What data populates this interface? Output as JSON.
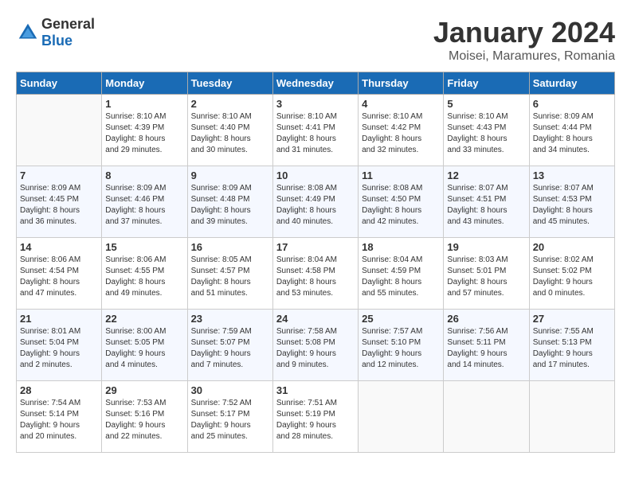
{
  "logo": {
    "general": "General",
    "blue": "Blue"
  },
  "header": {
    "month": "January 2024",
    "location": "Moisei, Maramures, Romania"
  },
  "weekdays": [
    "Sunday",
    "Monday",
    "Tuesday",
    "Wednesday",
    "Thursday",
    "Friday",
    "Saturday"
  ],
  "weeks": [
    [
      {
        "day": "",
        "info": ""
      },
      {
        "day": "1",
        "info": "Sunrise: 8:10 AM\nSunset: 4:39 PM\nDaylight: 8 hours\nand 29 minutes."
      },
      {
        "day": "2",
        "info": "Sunrise: 8:10 AM\nSunset: 4:40 PM\nDaylight: 8 hours\nand 30 minutes."
      },
      {
        "day": "3",
        "info": "Sunrise: 8:10 AM\nSunset: 4:41 PM\nDaylight: 8 hours\nand 31 minutes."
      },
      {
        "day": "4",
        "info": "Sunrise: 8:10 AM\nSunset: 4:42 PM\nDaylight: 8 hours\nand 32 minutes."
      },
      {
        "day": "5",
        "info": "Sunrise: 8:10 AM\nSunset: 4:43 PM\nDaylight: 8 hours\nand 33 minutes."
      },
      {
        "day": "6",
        "info": "Sunrise: 8:09 AM\nSunset: 4:44 PM\nDaylight: 8 hours\nand 34 minutes."
      }
    ],
    [
      {
        "day": "7",
        "info": "Sunrise: 8:09 AM\nSunset: 4:45 PM\nDaylight: 8 hours\nand 36 minutes."
      },
      {
        "day": "8",
        "info": "Sunrise: 8:09 AM\nSunset: 4:46 PM\nDaylight: 8 hours\nand 37 minutes."
      },
      {
        "day": "9",
        "info": "Sunrise: 8:09 AM\nSunset: 4:48 PM\nDaylight: 8 hours\nand 39 minutes."
      },
      {
        "day": "10",
        "info": "Sunrise: 8:08 AM\nSunset: 4:49 PM\nDaylight: 8 hours\nand 40 minutes."
      },
      {
        "day": "11",
        "info": "Sunrise: 8:08 AM\nSunset: 4:50 PM\nDaylight: 8 hours\nand 42 minutes."
      },
      {
        "day": "12",
        "info": "Sunrise: 8:07 AM\nSunset: 4:51 PM\nDaylight: 8 hours\nand 43 minutes."
      },
      {
        "day": "13",
        "info": "Sunrise: 8:07 AM\nSunset: 4:53 PM\nDaylight: 8 hours\nand 45 minutes."
      }
    ],
    [
      {
        "day": "14",
        "info": "Sunrise: 8:06 AM\nSunset: 4:54 PM\nDaylight: 8 hours\nand 47 minutes."
      },
      {
        "day": "15",
        "info": "Sunrise: 8:06 AM\nSunset: 4:55 PM\nDaylight: 8 hours\nand 49 minutes."
      },
      {
        "day": "16",
        "info": "Sunrise: 8:05 AM\nSunset: 4:57 PM\nDaylight: 8 hours\nand 51 minutes."
      },
      {
        "day": "17",
        "info": "Sunrise: 8:04 AM\nSunset: 4:58 PM\nDaylight: 8 hours\nand 53 minutes."
      },
      {
        "day": "18",
        "info": "Sunrise: 8:04 AM\nSunset: 4:59 PM\nDaylight: 8 hours\nand 55 minutes."
      },
      {
        "day": "19",
        "info": "Sunrise: 8:03 AM\nSunset: 5:01 PM\nDaylight: 8 hours\nand 57 minutes."
      },
      {
        "day": "20",
        "info": "Sunrise: 8:02 AM\nSunset: 5:02 PM\nDaylight: 9 hours\nand 0 minutes."
      }
    ],
    [
      {
        "day": "21",
        "info": "Sunrise: 8:01 AM\nSunset: 5:04 PM\nDaylight: 9 hours\nand 2 minutes."
      },
      {
        "day": "22",
        "info": "Sunrise: 8:00 AM\nSunset: 5:05 PM\nDaylight: 9 hours\nand 4 minutes."
      },
      {
        "day": "23",
        "info": "Sunrise: 7:59 AM\nSunset: 5:07 PM\nDaylight: 9 hours\nand 7 minutes."
      },
      {
        "day": "24",
        "info": "Sunrise: 7:58 AM\nSunset: 5:08 PM\nDaylight: 9 hours\nand 9 minutes."
      },
      {
        "day": "25",
        "info": "Sunrise: 7:57 AM\nSunset: 5:10 PM\nDaylight: 9 hours\nand 12 minutes."
      },
      {
        "day": "26",
        "info": "Sunrise: 7:56 AM\nSunset: 5:11 PM\nDaylight: 9 hours\nand 14 minutes."
      },
      {
        "day": "27",
        "info": "Sunrise: 7:55 AM\nSunset: 5:13 PM\nDaylight: 9 hours\nand 17 minutes."
      }
    ],
    [
      {
        "day": "28",
        "info": "Sunrise: 7:54 AM\nSunset: 5:14 PM\nDaylight: 9 hours\nand 20 minutes."
      },
      {
        "day": "29",
        "info": "Sunrise: 7:53 AM\nSunset: 5:16 PM\nDaylight: 9 hours\nand 22 minutes."
      },
      {
        "day": "30",
        "info": "Sunrise: 7:52 AM\nSunset: 5:17 PM\nDaylight: 9 hours\nand 25 minutes."
      },
      {
        "day": "31",
        "info": "Sunrise: 7:51 AM\nSunset: 5:19 PM\nDaylight: 9 hours\nand 28 minutes."
      },
      {
        "day": "",
        "info": ""
      },
      {
        "day": "",
        "info": ""
      },
      {
        "day": "",
        "info": ""
      }
    ]
  ]
}
